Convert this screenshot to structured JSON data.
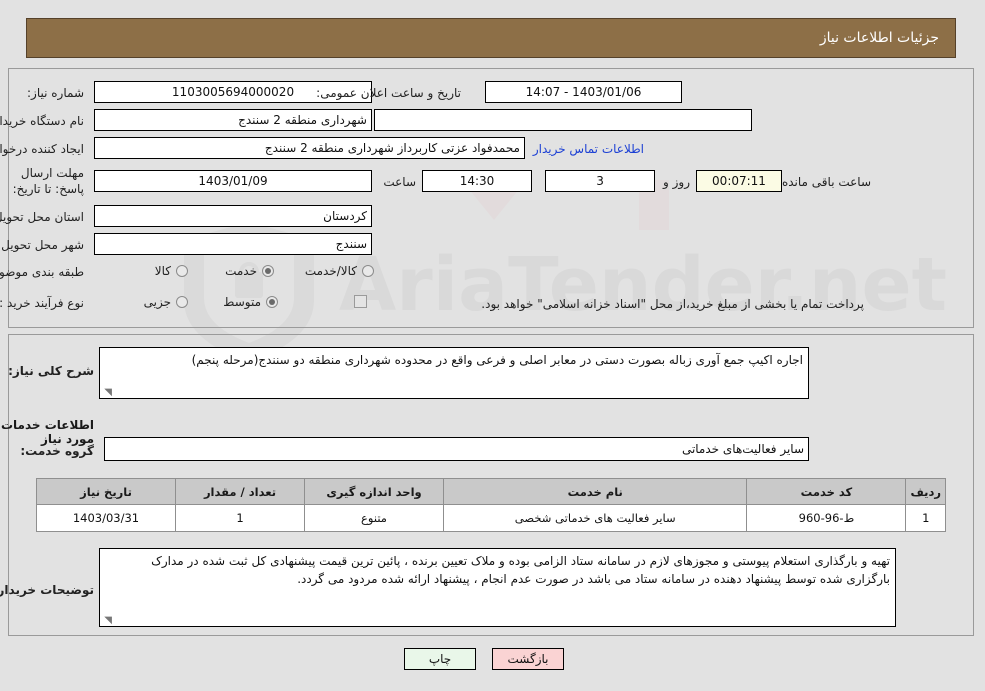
{
  "header": {
    "title": "جزئیات اطلاعات نیاز"
  },
  "watermark": {
    "text": "AriaTender.net"
  },
  "top_form": {
    "need_number": {
      "label": "شماره نیاز:",
      "value": "1103005694000020"
    },
    "public_announcement": {
      "label": "تاریخ و ساعت اعلان عمومی:",
      "value": "14:07 - 1403/01/06"
    },
    "buyer_org": {
      "label": "نام دستگاه خریدار:",
      "value": "شهرداری منطقه 2 سنندج"
    },
    "extra_org": {
      "value": ""
    },
    "request_creator": {
      "label": "ایجاد کننده درخواست:",
      "value": "محمدفواد عزتی کاربرداز شهرداری منطقه 2 سنندج"
    },
    "buyer_contact_link": {
      "label": "اطلاعات تماس خریدار"
    },
    "deadline": {
      "label": "مهلت ارسال پاسخ: تا تاریخ:",
      "date": "1403/01/09",
      "time_label": "ساعت",
      "time": "14:30",
      "days": "3",
      "days_label": "روز و",
      "countdown": "00:07:11",
      "countdown_label": "ساعت باقی مانده"
    },
    "province": {
      "label": "استان محل تحویل:",
      "value": "کردستان"
    },
    "city": {
      "label": "شهر محل تحویل:",
      "value": "سنندج"
    },
    "category": {
      "label": "طبقه بندی موضوعی:",
      "options": [
        "کالا",
        "خدمت",
        "کالا/خدمت"
      ],
      "selected": "خدمت"
    },
    "purchase_process": {
      "label": "نوع فرآیند خرید :",
      "options": [
        "جزیی",
        "متوسط"
      ],
      "selected": "متوسط"
    },
    "treasury_note": {
      "label": "پرداخت تمام یا بخشی از مبلغ خرید،از محل \"اسناد خزانه اسلامی\" خواهد بود.",
      "checked": false
    }
  },
  "bottom_section": {
    "general_description": {
      "label": "شرح کلی نیاز:",
      "value": "اجاره اکیپ جمع آوری زباله بصورت دستی در معابر اصلی و فرعی واقع در محدوده شهرداری منطقه دو سنندج(مرحله پنجم)"
    },
    "services_heading": "اطلاعات خدمات مورد نیاز",
    "service_group": {
      "label": "گروه خدمت:",
      "value": "سایر فعالیت‌های خدماتی"
    },
    "table": {
      "columns": [
        "ردیف",
        "کد خدمت",
        "نام خدمت",
        "واحد اندازه گیری",
        "تعداد / مقدار",
        "تاریخ نیاز"
      ],
      "rows": [
        {
          "row": "1",
          "code": "ط-96-960",
          "name": "سایر فعالیت های خدماتی شخصی",
          "unit": "متنوع",
          "quantity": "1",
          "date": "1403/03/31"
        }
      ]
    },
    "buyer_notes": {
      "label": "توضیحات خریدار:",
      "value": "تهیه و بارگذاری استعلام پیوستی و مجوزهای لازم در سامانه ستاد الزامی بوده و ملاک تعیین برنده ، پائین ترین قیمت پیشنهادی کل ثبت شده در مدارک بارگزاری شده توسط پیشنهاد دهنده در سامانه ستاد می باشد در صورت عدم انجام ، پیشنهاد ارائه شده مردود می گردد."
    }
  },
  "footer": {
    "print_label": "چاپ",
    "back_label": "بازگشت"
  },
  "colors": {
    "header_brown": "#8d6f47",
    "link_blue": "#1b3fd4",
    "page_bg": "#e2e2e2",
    "table_header": "#c9c9c9",
    "countdown_bg": "#fbfbe4",
    "print_bg": "#e9f7e9",
    "back_bg": "#fad3d3"
  }
}
